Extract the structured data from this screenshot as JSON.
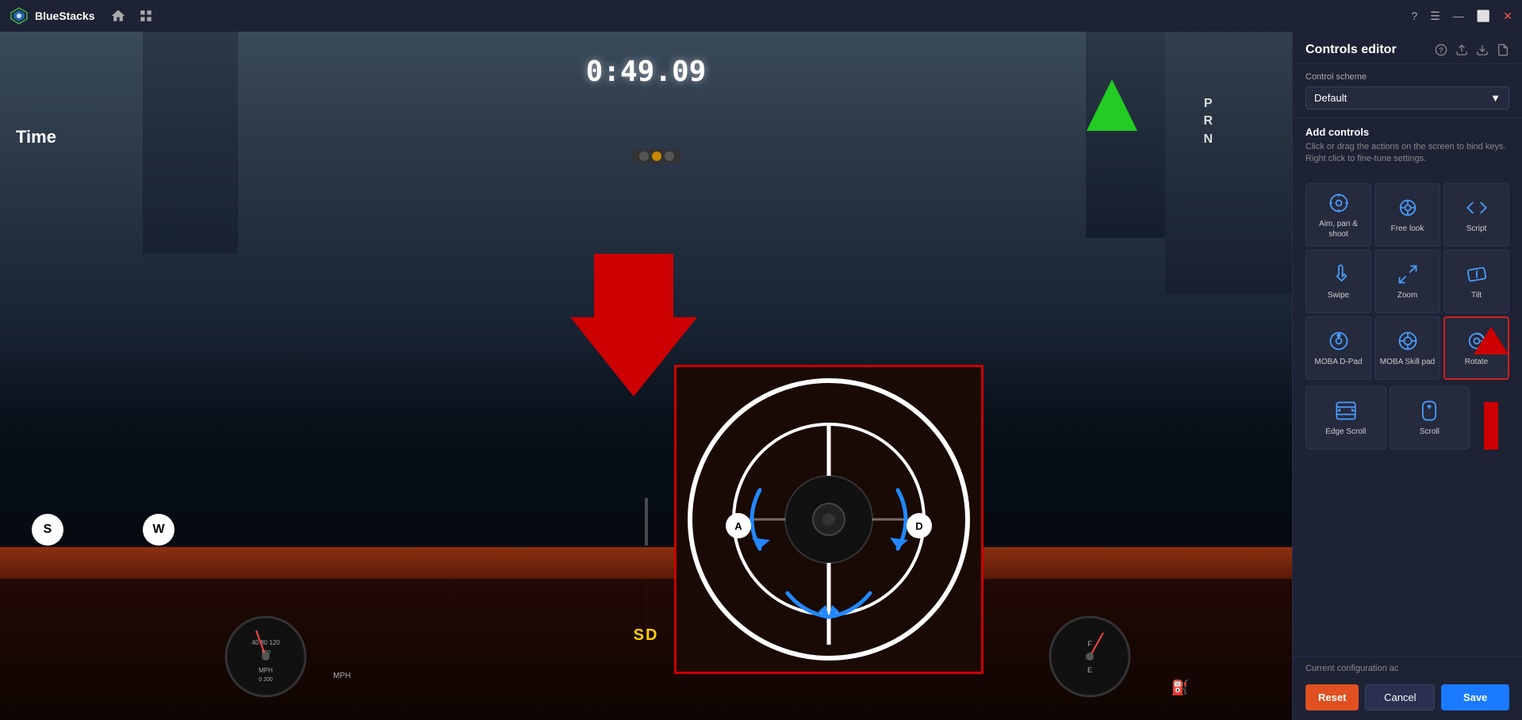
{
  "titleBar": {
    "appName": "BlueStacks",
    "homeIcon": "home-icon",
    "menuIcon": "menu-icon",
    "helpIcon": "help-icon",
    "minimizeIcon": "minimize-icon",
    "maximizeIcon": "maximize-icon",
    "closeIcon": "close-icon"
  },
  "gameArea": {
    "timer": "0:49.09",
    "timeLabel": "Time",
    "gearPositions": [
      "P",
      "R",
      "N"
    ],
    "keyS": "S",
    "keyW": "W",
    "sdBadge": "SD"
  },
  "controlsPanel": {
    "title": "Controls editor",
    "schemeLabel": "Control scheme",
    "schemeValue": "Default",
    "addControlsTitle": "Add controls",
    "addControlsDesc": "Click or drag the actions on the screen to bind keys. Right click to fine-tune settings.",
    "controls": [
      {
        "id": "aim-pan-shoot",
        "label": "Aim, pan & shoot",
        "icon": "aim-icon"
      },
      {
        "id": "free-look",
        "label": "Free look",
        "icon": "freelook-icon"
      },
      {
        "id": "script",
        "label": "Script",
        "icon": "script-icon"
      },
      {
        "id": "swipe",
        "label": "Swipe",
        "icon": "swipe-icon"
      },
      {
        "id": "zoom",
        "label": "Zoom",
        "icon": "zoom-icon"
      },
      {
        "id": "tilt",
        "label": "Tilt",
        "icon": "tilt-icon"
      },
      {
        "id": "moba-dpad",
        "label": "MOBA D-Pad",
        "icon": "moba-dpad-icon"
      },
      {
        "id": "moba-skill",
        "label": "MOBA Skill pad",
        "icon": "moba-skill-icon"
      },
      {
        "id": "rotate",
        "label": "Rotate",
        "icon": "rotate-icon",
        "selected": true
      }
    ],
    "scrollControls": [
      {
        "id": "edge-scroll",
        "label": "Edge Scroll",
        "icon": "edge-scroll-icon"
      },
      {
        "id": "scroll",
        "label": "Scroll",
        "icon": "scroll-icon"
      }
    ],
    "currentConfigLabel": "Current configuration ac",
    "resetLabel": "Reset",
    "cancelLabel": "Cancel",
    "saveLabel": "Save"
  }
}
